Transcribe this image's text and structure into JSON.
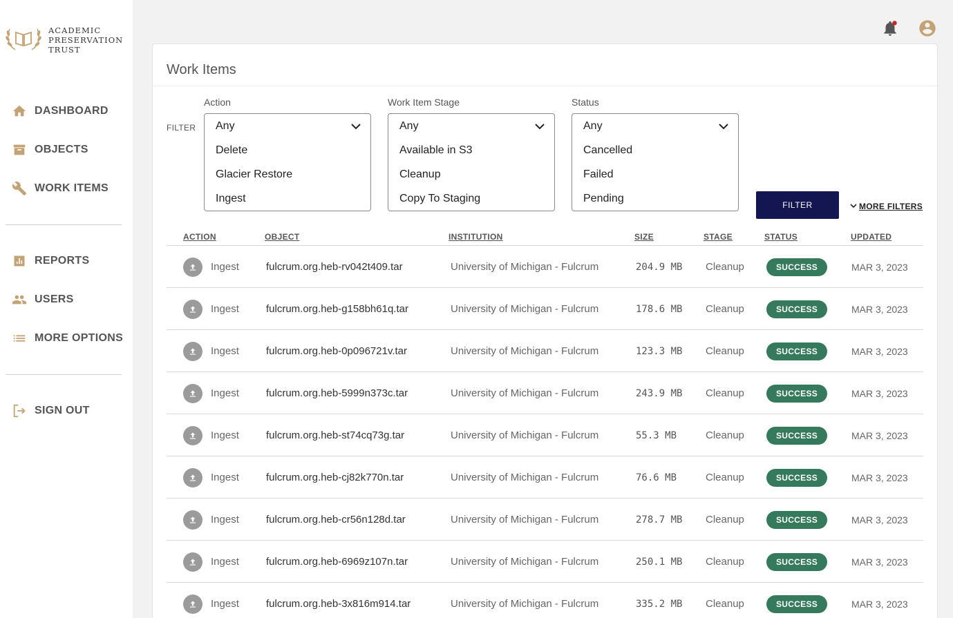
{
  "brand": {
    "line1": "ACADEMIC",
    "line2": "PRESERVATION",
    "line3": "TRUST",
    "accent": "#c4a273"
  },
  "nav": [
    {
      "label": "DASHBOARD",
      "icon": "home-icon"
    },
    {
      "label": "OBJECTS",
      "icon": "archive-icon"
    },
    {
      "label": "WORK ITEMS",
      "icon": "wrench-icon"
    },
    {
      "label": "REPORTS",
      "icon": "chart-icon"
    },
    {
      "label": "USERS",
      "icon": "users-icon"
    },
    {
      "label": "MORE OPTIONS",
      "icon": "list-icon"
    },
    {
      "label": "SIGN OUT",
      "icon": "sign-out-icon"
    }
  ],
  "page": {
    "title": "Work Items",
    "filter_label": "FILTER"
  },
  "filters": {
    "action": {
      "title": "Action",
      "options": [
        "Any",
        "Delete",
        "Glacier Restore",
        "Ingest"
      ]
    },
    "stage": {
      "title": "Work Item Stage",
      "options": [
        "Any",
        "Available in S3",
        "Cleanup",
        "Copy To Staging"
      ]
    },
    "status": {
      "title": "Status",
      "options": [
        "Any",
        "Cancelled",
        "Failed",
        "Pending"
      ]
    },
    "filter_button": "FILTER",
    "more_filters": "MORE FILTERS"
  },
  "table": {
    "headers": {
      "action": "ACTION",
      "object": "OBJECT",
      "institution": "INSTITUTION",
      "size": "SIZE",
      "stage": "STAGE",
      "status": "STATUS",
      "updated": "UPDATED"
    },
    "rows": [
      {
        "action": "Ingest",
        "object": "fulcrum.org.heb-rv042t409.tar",
        "institution": "University of Michigan - Fulcrum",
        "size": "204.9 MB",
        "stage": "Cleanup",
        "status": "SUCCESS",
        "updated": "MAR 3, 2023"
      },
      {
        "action": "Ingest",
        "object": "fulcrum.org.heb-g158bh61q.tar",
        "institution": "University of Michigan - Fulcrum",
        "size": "178.6 MB",
        "stage": "Cleanup",
        "status": "SUCCESS",
        "updated": "MAR 3, 2023"
      },
      {
        "action": "Ingest",
        "object": "fulcrum.org.heb-0p096721v.tar",
        "institution": "University of Michigan - Fulcrum",
        "size": "123.3 MB",
        "stage": "Cleanup",
        "status": "SUCCESS",
        "updated": "MAR 3, 2023"
      },
      {
        "action": "Ingest",
        "object": "fulcrum.org.heb-5999n373c.tar",
        "institution": "University of Michigan - Fulcrum",
        "size": "243.9 MB",
        "stage": "Cleanup",
        "status": "SUCCESS",
        "updated": "MAR 3, 2023"
      },
      {
        "action": "Ingest",
        "object": "fulcrum.org.heb-st74cq73g.tar",
        "institution": "University of Michigan - Fulcrum",
        "size": "55.3 MB",
        "stage": "Cleanup",
        "status": "SUCCESS",
        "updated": "MAR 3, 2023"
      },
      {
        "action": "Ingest",
        "object": "fulcrum.org.heb-cj82k770n.tar",
        "institution": "University of Michigan - Fulcrum",
        "size": "76.6 MB",
        "stage": "Cleanup",
        "status": "SUCCESS",
        "updated": "MAR 3, 2023"
      },
      {
        "action": "Ingest",
        "object": "fulcrum.org.heb-cr56n128d.tar",
        "institution": "University of Michigan - Fulcrum",
        "size": "278.7 MB",
        "stage": "Cleanup",
        "status": "SUCCESS",
        "updated": "MAR 3, 2023"
      },
      {
        "action": "Ingest",
        "object": "fulcrum.org.heb-6969z107n.tar",
        "institution": "University of Michigan - Fulcrum",
        "size": "250.1 MB",
        "stage": "Cleanup",
        "status": "SUCCESS",
        "updated": "MAR 3, 2023"
      },
      {
        "action": "Ingest",
        "object": "fulcrum.org.heb-3x816m914.tar",
        "institution": "University of Michigan - Fulcrum",
        "size": "335.2 MB",
        "stage": "Cleanup",
        "status": "SUCCESS",
        "updated": "MAR 3, 2023"
      }
    ]
  },
  "colors": {
    "primary_button": "#141652",
    "success": "#357a5c",
    "brand_gold": "#c4a273",
    "notification_dot": "#c62828"
  }
}
